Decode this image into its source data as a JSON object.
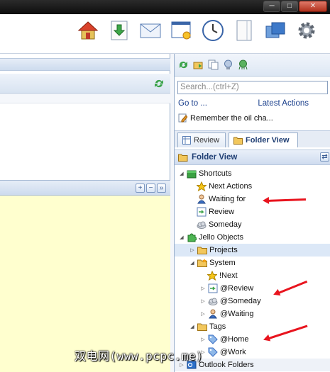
{
  "window_buttons": [
    "─",
    "□",
    "✕"
  ],
  "toolbar": {
    "icons": [
      "home-icon",
      "inbox-download-icon",
      "mail-icon",
      "new-window-icon",
      "clock-icon",
      "notebook-icon",
      "windows-icon",
      "settings-gear-icon"
    ]
  },
  "right_panel": {
    "search_placeholder": "Search...(ctrl+Z)",
    "goto_label": "Go to ...",
    "latest_actions_label": "Latest Actions",
    "recent_item": "Remember the oil cha...",
    "tabs": [
      {
        "label": "Review",
        "active": false
      },
      {
        "label": "Folder View",
        "active": true
      }
    ],
    "folder_view_title": "Folder View",
    "tree": [
      {
        "label": "Shortcuts",
        "level": 0,
        "expanded": true,
        "icon": "green-box-icon",
        "selected": false
      },
      {
        "label": "Next Actions",
        "level": 1,
        "icon": "star-icon",
        "selected": false
      },
      {
        "label": "Waiting for",
        "level": 1,
        "icon": "person-icon",
        "selected": false
      },
      {
        "label": "Review",
        "level": 1,
        "icon": "review-icon",
        "selected": false
      },
      {
        "label": "Someday",
        "level": 1,
        "icon": "cloud-icon",
        "selected": false
      },
      {
        "label": "Jello Objects",
        "level": 0,
        "expanded": true,
        "icon": "puzzle-icon",
        "selected": false
      },
      {
        "label": "Projects",
        "level": 1,
        "icon": "folder-icon",
        "selected": true
      },
      {
        "label": "System",
        "level": 1,
        "expanded": true,
        "icon": "folder-star-icon",
        "selected": false
      },
      {
        "label": "!Next",
        "level": 2,
        "icon": "star-icon",
        "selected": false
      },
      {
        "label": "@Review",
        "level": 2,
        "icon": "review-icon",
        "selected": false
      },
      {
        "label": "@Someday",
        "level": 2,
        "icon": "cloud-icon",
        "selected": false
      },
      {
        "label": "@Waiting",
        "level": 2,
        "icon": "person-icon",
        "selected": false
      },
      {
        "label": "Tags",
        "level": 1,
        "expanded": true,
        "icon": "folder-icon",
        "selected": false
      },
      {
        "label": "@Home",
        "level": 2,
        "icon": "tag-icon",
        "selected": false
      },
      {
        "label": "@Work",
        "level": 2,
        "icon": "tag-icon",
        "selected": false
      },
      {
        "label": "Outlook Folders",
        "level": 0,
        "icon": "outlook-icon",
        "selected": false
      }
    ]
  },
  "watermark": "双电网(www.pcpc.me)",
  "colors": {
    "accent": "#1f3e73",
    "notes_bg": "#ffffcf",
    "annotation_arrow": "#e8141e"
  }
}
